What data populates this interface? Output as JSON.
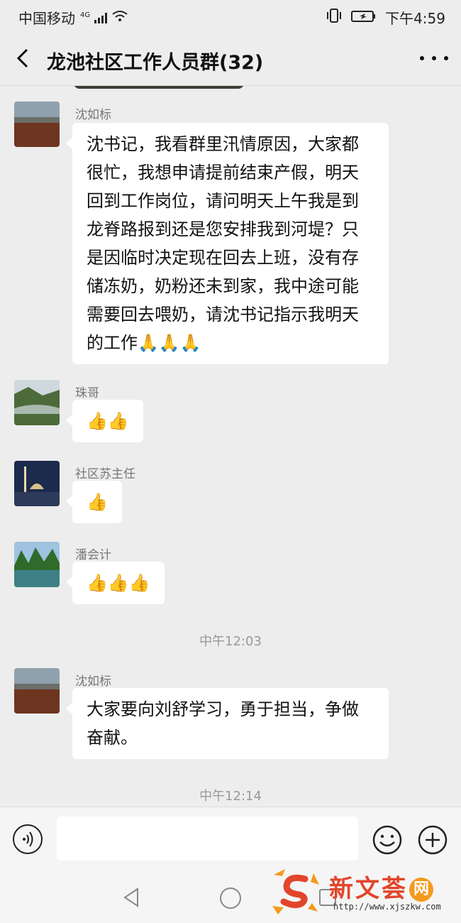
{
  "status_bar": {
    "carrier": "中国移动",
    "network": "4G",
    "time": "下午4:59"
  },
  "header": {
    "title": "龙池社区工作人员群(32)"
  },
  "messages": [
    {
      "sender": "沈如标",
      "text": "沈书记，我看群里汛情原因，大家都很忙，我想申请提前结束产假，明天回到工作岗位，请问明天上午我是到龙脊路报到还是您安排我到河堤？只是因临时决定现在回去上班，没有存储冻奶，奶粉还未到家，我中途可能需要回去喂奶，请沈书记指示我明天的工作",
      "emoji": [
        "praying-hands",
        "praying-hands",
        "praying-hands"
      ],
      "emoji_chars": "🙏🙏🙏"
    },
    {
      "sender": "珠哥",
      "emoji": [
        "thumbs-up",
        "thumbs-up"
      ],
      "emoji_chars": "👍👍"
    },
    {
      "sender": "社区苏主任",
      "emoji": [
        "thumbs-up"
      ],
      "emoji_chars": "👍"
    },
    {
      "sender": "潘会计",
      "emoji": [
        "thumbs-up",
        "thumbs-up",
        "thumbs-up"
      ],
      "emoji_chars": "👍👍👍"
    },
    {
      "sender": "沈如标",
      "text": "大家要向刘舒学习，勇于担当，争做奋献。"
    }
  ],
  "timestamps": [
    "中午12:03",
    "中午12:14"
  ],
  "input": {
    "placeholder": "",
    "value": ""
  },
  "icons": {
    "back": "chevron-left-icon",
    "more": "more-icon",
    "voice": "voice-icon",
    "emoji": "smiley-icon",
    "plus": "plus-icon"
  },
  "watermark": {
    "brand": "新文荟",
    "net": "网",
    "url": "http://www.xjszkw.com"
  },
  "colors": {
    "background": "#ededed",
    "bubble": "#ffffff",
    "watermark_red": "#e2452b",
    "watermark_orange": "#f39a1e"
  }
}
